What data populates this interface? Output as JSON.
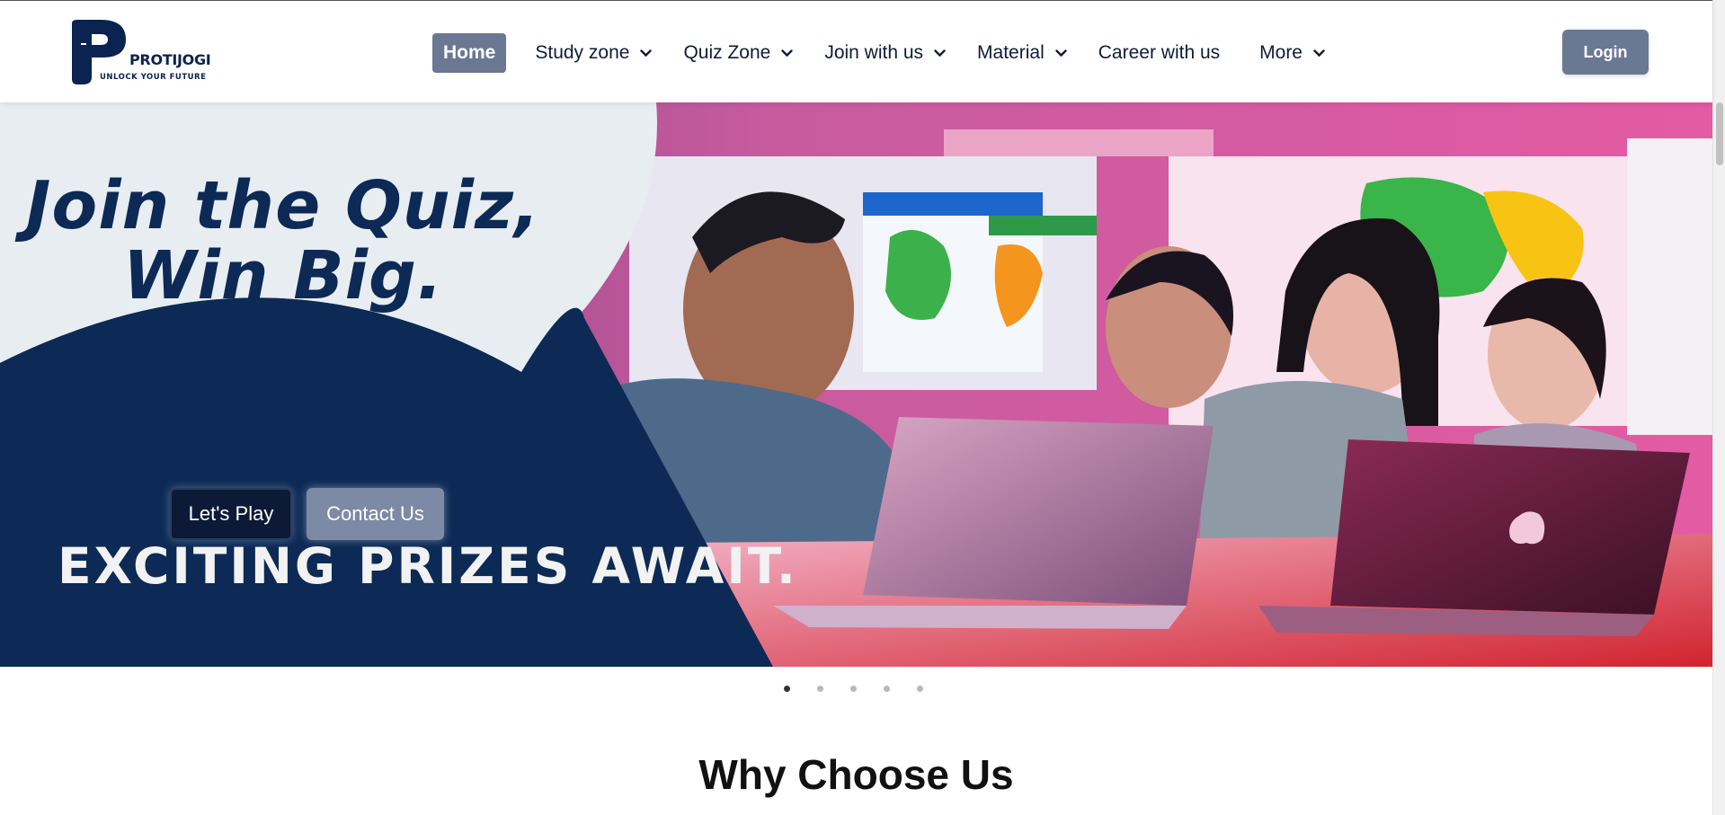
{
  "brand": {
    "name": "PROTIJOGI",
    "tagline": "UNLOCK YOUR FUTURE",
    "color": "#0b2350"
  },
  "nav": {
    "items": [
      {
        "label": "Home",
        "active": true,
        "dropdown": false
      },
      {
        "label": "Study zone",
        "dropdown": true
      },
      {
        "label": "Quiz Zone",
        "dropdown": true
      },
      {
        "label": "Join with us",
        "dropdown": true
      },
      {
        "label": "Material",
        "dropdown": true
      },
      {
        "label": "Career with us",
        "dropdown": false
      },
      {
        "label": "More",
        "dropdown": true
      }
    ],
    "login_label": "Login",
    "accent": "#6b7893"
  },
  "hero": {
    "heading_line1": "Join the Quiz,",
    "heading_line2": "Win Big.",
    "subheading": "EXCITING PRIZES AWAIT.",
    "play_label": "Let's Play",
    "contact_label": "Contact Us",
    "navy": "#0c2a55"
  },
  "carousel": {
    "slide_count": 5,
    "active_index": 0
  },
  "section": {
    "title": "Why Choose Us"
  }
}
